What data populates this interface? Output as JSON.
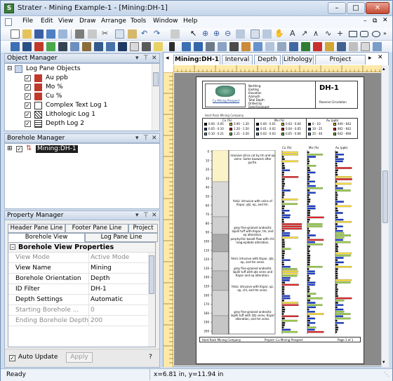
{
  "window": {
    "title": "Strater - Mining Example-1 - [Mining:DH-1]"
  },
  "menu": [
    "File",
    "Edit",
    "View",
    "Draw",
    "Arrange",
    "Tools",
    "Window",
    "Help"
  ],
  "object_manager": {
    "title": "Object Manager",
    "root": "Log Pane Objects",
    "items": [
      "Au ppb",
      "Mo %",
      "Cu %",
      "Complex Text Log 1",
      "Lithologic Log 1",
      "Depth Log 2"
    ]
  },
  "borehole_manager": {
    "title": "Borehole Manager",
    "item": "Mining:DH-1"
  },
  "property_manager": {
    "title": "Property Manager",
    "tabs_row1": [
      "Header Pane Line",
      "Footer Pane Line",
      "Project"
    ],
    "tabs_row2": [
      "Borehole View",
      "Log Pane Line"
    ],
    "section": "Borehole View Properties",
    "rows": [
      {
        "k": "View Mode",
        "v": "Active Mode",
        "dim": true
      },
      {
        "k": "View Name",
        "v": "Mining",
        "dim": false
      },
      {
        "k": "Borehole Orientation",
        "v": "Depth",
        "dim": false
      },
      {
        "k": "ID Filter",
        "v": "DH-1",
        "dim": false
      },
      {
        "k": "Depth Settings",
        "v": "Automatic",
        "dim": false
      },
      {
        "k": "Starting Borehole ...",
        "v": "0",
        "dim": true
      },
      {
        "k": "Ending Borehole Depth",
        "v": "200",
        "dim": true
      }
    ],
    "auto_update": "Auto Update",
    "apply": "Apply",
    "help": "?"
  },
  "doc_tabs": [
    "Mining:DH-1",
    "Interval",
    "Depth",
    "Lithology",
    "Project Settings"
  ],
  "page": {
    "project_link": "Cu Mining Prospect",
    "company": "Hard Rock Mining Company",
    "hole_id": "DH-1",
    "reverse": "Reverse Circulation",
    "info_labels": [
      "Northing",
      "Easting",
      "Elevation",
      "Azimuth",
      "Total Depth",
      "Drilled by",
      "Date/Geologist"
    ],
    "legend_titles": [
      "Cu (%)",
      "Mo (%)",
      "Au (ppb)"
    ],
    "legend_cu": [
      "0.00 - 0.05",
      "0.05 - 0.10",
      "0.10 - 0.21",
      "0.90 - 1.20",
      "1.20 - 1.50",
      "1.21 - 3.50"
    ],
    "legend_mo": [
      "0.00 - 0.01",
      "0.01 - 0.02",
      "0.02 - 0.03",
      "0.03 - 0.04",
      "0.04 - 0.05",
      "0.05 - 0.06"
    ],
    "legend_au": [
      "0 - 10",
      "10 - 25",
      "25 - 40",
      "440 - 642",
      "462 - 642",
      "642 - 690"
    ],
    "col_heads": [
      "Cu (%)",
      "Mo (%)",
      "Au (ppb)"
    ],
    "depths": [
      "0",
      "10",
      "20",
      "30",
      "40",
      "50",
      "60",
      "70",
      "80",
      "90",
      "100",
      "110",
      "120",
      "130",
      "140",
      "150",
      "160",
      "170",
      "180",
      "190",
      "200"
    ],
    "lith_text": [
      "massive silica cut by tm and ep veins. Some boxwork after pyrite.",
      "felsic intrusive with veins of Kspar, qtz, ep, and tm.",
      "grey fine-grained andesitic lapilli tuff with Kspar, tm, and ep alteration.",
      "porphyritic basalt flow with chl-mag-epidote alteration.",
      "felsic intrusive with Kspar, qtz, ep, and tm veins.",
      "grey fine-grained andesitic lapilli tuff with qtz veins and Kspar and ep alteration.",
      "felsic intrusive with Kspar, qz, ep, chl, and tm veins.",
      "grey fine-grained andesitic lapilli tuff with Qtz veins, Kspar alteration, and tm veins."
    ],
    "footer": [
      "Hard Rock Mining Company",
      "Project: Cu Mining Prospect",
      "Page 1 of 1"
    ]
  },
  "status": {
    "left": "Ready",
    "coords": "x=6.81 in, y=11.94 in"
  },
  "colors": {
    "accent": "#3d6fb5",
    "panel": "#cfdcec"
  }
}
